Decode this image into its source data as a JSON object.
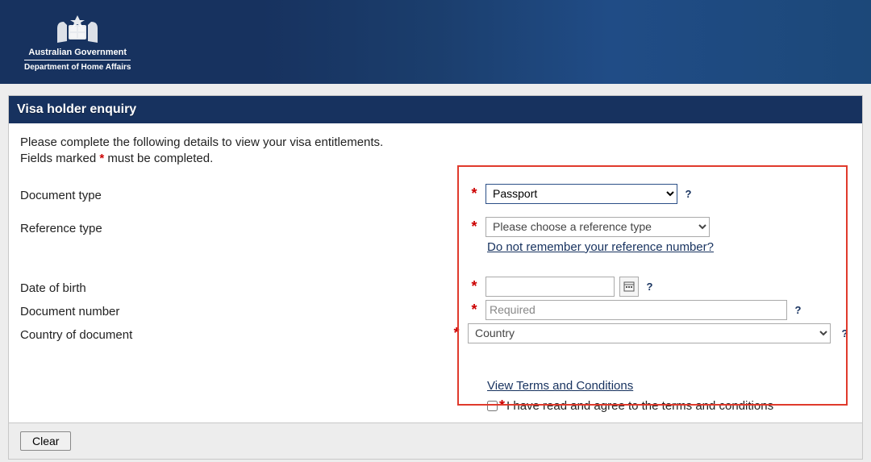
{
  "header": {
    "gov_line1": "Australian Government",
    "gov_line2": "Department of Home Affairs"
  },
  "panel": {
    "title": "Visa holder enquiry",
    "intro_line1": "Please complete the following details to view your visa entitlements.",
    "intro_line2_prefix": "Fields marked ",
    "intro_line2_mark": "*",
    "intro_line2_suffix": " must be completed."
  },
  "form": {
    "document_type": {
      "label": "Document type",
      "value": "Passport"
    },
    "reference_type": {
      "label": "Reference type",
      "placeholder": "Please choose a reference type",
      "forgot_link": "Do not remember your reference number?"
    },
    "date_of_birth": {
      "label": "Date of birth",
      "value": ""
    },
    "document_number": {
      "label": "Document number",
      "placeholder": "Required",
      "value": ""
    },
    "country": {
      "label": "Country of document",
      "placeholder": "Country"
    },
    "terms_link": "View Terms and Conditions",
    "terms_check_label": "I have read and agree to the terms and conditions"
  },
  "footer": {
    "clear": "Clear"
  },
  "icons": {
    "help": "?",
    "asterisk": "*"
  }
}
